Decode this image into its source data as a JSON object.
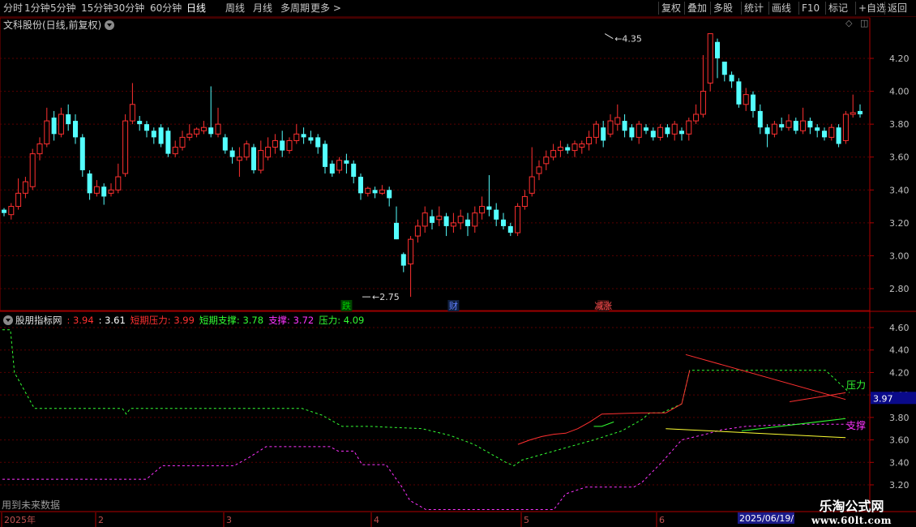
{
  "toolbar": {
    "left": [
      {
        "label": "分时",
        "active": false
      },
      {
        "label": "1分钟",
        "active": false
      },
      {
        "label": "5分钟",
        "active": false
      },
      {
        "label": "15分钟",
        "active": false
      },
      {
        "label": "30分钟",
        "active": false
      },
      {
        "label": "60分钟",
        "active": false
      },
      {
        "label": "日线",
        "active": true
      },
      {
        "label": "周线",
        "active": false
      },
      {
        "label": "月线",
        "active": false
      },
      {
        "label": "多周期",
        "active": false
      },
      {
        "label": "更多 >",
        "active": false
      }
    ],
    "right": [
      "复权",
      "叠加",
      "多股",
      "统计",
      "画线",
      "F10",
      "标记",
      "+自选",
      "返回"
    ]
  },
  "main_title": "文科股份(日线,前复权)",
  "indicator": {
    "name": "股朋指标网",
    "items": [
      {
        "label": "",
        "value": "3.94",
        "label_color": "#ff3030",
        "value_color": "#ff3030"
      },
      {
        "label": "",
        "value": "3.61",
        "label_color": "#ffffff",
        "value_color": "#ffffff"
      },
      {
        "label": "短期压力",
        "value": "3.99",
        "label_color": "#ff3030",
        "value_color": "#ff3030"
      },
      {
        "label": "短期支撑",
        "value": "3.78",
        "label_color": "#33ff33",
        "value_color": "#33ff33"
      },
      {
        "label": "支撑",
        "value": "3.72",
        "label_color": "#ff33ff",
        "value_color": "#ff33ff"
      },
      {
        "label": "压力",
        "value": "4.09",
        "label_color": "#33ff33",
        "value_color": "#33ff33"
      }
    ],
    "pressure_label": "压力",
    "support_label": "支撑",
    "current_value": "3.97"
  },
  "future_note": "用到未来数据",
  "watermark": {
    "line1": "乐淘公式网",
    "line2": "www.60lt.com"
  },
  "colors": {
    "up": "#ff3030",
    "down": "#54ffff",
    "grid": "#5a0000",
    "axis_text": "#c0c0c0"
  },
  "chart_data": {
    "type": "candlestick",
    "price_axis": {
      "ticks": [
        "4.20",
        "4.00",
        "3.80",
        "3.60",
        "3.40",
        "3.20",
        "3.00",
        "2.80"
      ],
      "range": [
        2.72,
        4.38
      ]
    },
    "indicator_axis": {
      "ticks": [
        "4.60",
        "4.40",
        "4.20",
        "4.00",
        "3.80",
        "3.60",
        "3.40",
        "3.20"
      ],
      "range": [
        3.12,
        4.68
      ]
    },
    "annotations": [
      {
        "text": "4.35",
        "index": 84,
        "value": 4.35
      },
      {
        "text": "2.75",
        "index": 50,
        "value": 2.75
      }
    ],
    "event_markers": [
      {
        "text": "跌",
        "index": 48,
        "color": "#00cc00",
        "bg": "#004400"
      },
      {
        "text": "财",
        "index": 63,
        "color": "#6080ff",
        "bg": "#102040"
      },
      {
        "text": "涨",
        "index": 84,
        "color": "#ff5050",
        "bg": "#401010",
        "prefix": "减"
      }
    ],
    "date_labels": [
      {
        "text": "2025年",
        "index": 0
      },
      {
        "text": "2",
        "index": 12
      },
      {
        "text": "3",
        "index": 28
      },
      {
        "text": "4",
        "index": 46
      },
      {
        "text": "5",
        "index": 65
      },
      {
        "text": "6",
        "index": 82
      }
    ],
    "date_cursor": "2025/06/19/",
    "candles": [
      [
        3.28,
        3.26,
        3.29,
        3.24
      ],
      [
        3.25,
        3.3,
        3.32,
        3.22
      ],
      [
        3.3,
        3.38,
        3.47,
        3.28
      ],
      [
        3.38,
        3.45,
        3.48,
        3.35
      ],
      [
        3.42,
        3.62,
        3.65,
        3.4
      ],
      [
        3.62,
        3.68,
        3.72,
        3.58
      ],
      [
        3.68,
        3.82,
        3.9,
        3.66
      ],
      [
        3.84,
        3.74,
        3.88,
        3.7
      ],
      [
        3.74,
        3.86,
        3.9,
        3.72
      ],
      [
        3.86,
        3.8,
        3.92,
        3.76
      ],
      [
        3.82,
        3.72,
        3.86,
        3.68
      ],
      [
        3.72,
        3.52,
        3.74,
        3.48
      ],
      [
        3.5,
        3.38,
        3.52,
        3.34
      ],
      [
        3.38,
        3.42,
        3.46,
        3.36
      ],
      [
        3.42,
        3.36,
        3.44,
        3.31
      ],
      [
        3.38,
        3.4,
        3.44,
        3.36
      ],
      [
        3.4,
        3.48,
        3.56,
        3.38
      ],
      [
        3.5,
        3.82,
        3.86,
        3.48
      ],
      [
        3.82,
        3.92,
        4.05,
        3.8
      ],
      [
        3.82,
        3.8,
        3.85,
        3.76
      ],
      [
        3.8,
        3.76,
        3.82,
        3.72
      ],
      [
        3.76,
        3.72,
        3.78,
        3.68
      ],
      [
        3.78,
        3.68,
        3.8,
        3.66
      ],
      [
        3.76,
        3.62,
        3.78,
        3.6
      ],
      [
        3.62,
        3.66,
        3.7,
        3.6
      ],
      [
        3.66,
        3.72,
        3.76,
        3.64
      ],
      [
        3.72,
        3.74,
        3.8,
        3.7
      ],
      [
        3.74,
        3.77,
        3.78,
        3.72
      ],
      [
        3.76,
        3.78,
        3.82,
        3.74
      ],
      [
        3.78,
        3.74,
        4.03,
        3.72
      ],
      [
        3.74,
        3.8,
        3.9,
        3.72
      ],
      [
        3.72,
        3.64,
        3.74,
        3.62
      ],
      [
        3.64,
        3.6,
        3.66,
        3.56
      ],
      [
        3.58,
        3.6,
        3.66,
        3.48
      ],
      [
        3.6,
        3.68,
        3.7,
        3.58
      ],
      [
        3.66,
        3.52,
        3.68,
        3.5
      ],
      [
        3.52,
        3.64,
        3.7,
        3.5
      ],
      [
        3.6,
        3.66,
        3.72,
        3.58
      ],
      [
        3.66,
        3.7,
        3.74,
        3.62
      ],
      [
        3.7,
        3.64,
        3.76,
        3.6
      ],
      [
        3.64,
        3.7,
        3.72,
        3.62
      ],
      [
        3.7,
        3.74,
        3.8,
        3.68
      ],
      [
        3.74,
        3.72,
        3.78,
        3.68
      ],
      [
        3.72,
        3.7,
        3.76,
        3.68
      ],
      [
        3.72,
        3.66,
        3.74,
        3.62
      ],
      [
        3.68,
        3.54,
        3.7,
        3.5
      ],
      [
        3.56,
        3.5,
        3.58,
        3.48
      ],
      [
        3.52,
        3.58,
        3.6,
        3.5
      ],
      [
        3.58,
        3.56,
        3.62,
        3.5
      ],
      [
        3.56,
        3.48,
        3.58,
        3.44
      ],
      [
        3.48,
        3.38,
        3.5,
        3.34
      ],
      [
        3.38,
        3.41,
        3.42,
        3.36
      ],
      [
        3.4,
        3.38,
        3.42,
        3.35
      ],
      [
        3.38,
        3.4,
        3.43,
        3.37
      ],
      [
        3.4,
        3.35,
        3.42,
        3.3
      ],
      [
        3.2,
        3.1,
        3.3,
        3.1
      ],
      [
        3.01,
        2.94,
        3.02,
        2.9
      ],
      [
        2.95,
        3.1,
        3.12,
        2.75
      ],
      [
        3.12,
        3.18,
        3.22,
        3.08
      ],
      [
        3.18,
        3.26,
        3.3,
        3.14
      ],
      [
        3.24,
        3.2,
        3.28,
        3.16
      ],
      [
        3.22,
        3.24,
        3.3,
        3.18
      ],
      [
        3.24,
        3.18,
        3.26,
        3.12
      ],
      [
        3.18,
        3.2,
        3.26,
        3.14
      ],
      [
        3.2,
        3.24,
        3.28,
        3.16
      ],
      [
        3.22,
        3.18,
        3.26,
        3.12
      ],
      [
        3.18,
        3.26,
        3.3,
        3.14
      ],
      [
        3.26,
        3.3,
        3.36,
        3.22
      ],
      [
        3.3,
        3.28,
        3.49,
        3.24
      ],
      [
        3.28,
        3.22,
        3.32,
        3.18
      ],
      [
        3.22,
        3.18,
        3.26,
        3.16
      ],
      [
        3.18,
        3.14,
        3.2,
        3.12
      ],
      [
        3.14,
        3.3,
        3.32,
        3.12
      ],
      [
        3.3,
        3.36,
        3.4,
        3.28
      ],
      [
        3.38,
        3.48,
        3.66,
        3.36
      ],
      [
        3.5,
        3.54,
        3.58,
        3.46
      ],
      [
        3.56,
        3.6,
        3.64,
        3.52
      ],
      [
        3.6,
        3.64,
        3.68,
        3.58
      ],
      [
        3.64,
        3.66,
        3.7,
        3.6
      ],
      [
        3.66,
        3.64,
        3.68,
        3.62
      ],
      [
        3.64,
        3.68,
        3.7,
        3.6
      ],
      [
        3.66,
        3.68,
        3.7,
        3.62
      ],
      [
        3.68,
        3.72,
        3.76,
        3.64
      ],
      [
        3.72,
        3.8,
        3.82,
        3.68
      ],
      [
        3.78,
        3.7,
        3.82,
        3.66
      ],
      [
        3.74,
        3.82,
        3.86,
        3.72
      ],
      [
        3.8,
        3.84,
        3.92,
        3.76
      ],
      [
        3.82,
        3.76,
        3.86,
        3.72
      ],
      [
        3.78,
        3.72,
        3.8,
        3.7
      ],
      [
        3.72,
        3.8,
        3.82,
        3.68
      ],
      [
        3.78,
        3.76,
        3.8,
        3.74
      ],
      [
        3.76,
        3.72,
        3.78,
        3.7
      ],
      [
        3.72,
        3.78,
        3.8,
        3.7
      ],
      [
        3.78,
        3.74,
        3.8,
        3.72
      ],
      [
        3.74,
        3.8,
        3.82,
        3.7
      ],
      [
        3.76,
        3.74,
        3.78,
        3.7
      ],
      [
        3.74,
        3.82,
        3.84,
        3.7
      ],
      [
        3.82,
        3.86,
        3.92,
        3.8
      ],
      [
        3.86,
        4.0,
        4.22,
        3.84
      ],
      [
        4.05,
        4.35,
        4.35,
        4.0
      ],
      [
        4.3,
        4.2,
        4.32,
        4.08
      ],
      [
        4.18,
        4.1,
        4.18,
        4.06
      ],
      [
        4.1,
        4.06,
        4.12,
        4.02
      ],
      [
        4.06,
        3.92,
        4.08,
        3.9
      ],
      [
        3.92,
        3.98,
        4.02,
        3.88
      ],
      [
        3.98,
        3.88,
        4.0,
        3.84
      ],
      [
        3.88,
        3.78,
        3.92,
        3.74
      ],
      [
        3.78,
        3.74,
        3.8,
        3.66
      ],
      [
        3.74,
        3.8,
        3.82,
        3.72
      ],
      [
        3.8,
        3.78,
        3.84,
        3.76
      ],
      [
        3.78,
        3.82,
        3.86,
        3.76
      ],
      [
        3.82,
        3.76,
        3.84,
        3.74
      ],
      [
        3.76,
        3.82,
        3.9,
        3.74
      ],
      [
        3.82,
        3.78,
        3.84,
        3.74
      ],
      [
        3.78,
        3.76,
        3.8,
        3.72
      ],
      [
        3.76,
        3.72,
        3.78,
        3.7
      ],
      [
        3.72,
        3.78,
        3.8,
        3.7
      ],
      [
        3.78,
        3.68,
        3.8,
        3.66
      ],
      [
        3.7,
        3.86,
        3.88,
        3.68
      ],
      [
        3.86,
        3.87,
        3.98,
        3.84
      ],
      [
        3.88,
        3.86,
        3.92,
        3.84
      ]
    ],
    "series": [
      {
        "name": "压力",
        "color": "#33ff33",
        "dashed": true,
        "points": [
          [
            0,
            4.58
          ],
          [
            2,
            4.58
          ],
          [
            3,
            4.2
          ],
          [
            8,
            3.88
          ],
          [
            30,
            3.88
          ],
          [
            31,
            3.83
          ],
          [
            32,
            3.88
          ],
          [
            70,
            3.88
          ],
          [
            75,
            3.88
          ],
          [
            80,
            3.82
          ],
          [
            85,
            3.72
          ],
          [
            92,
            3.72
          ],
          [
            105,
            3.7
          ],
          [
            112,
            3.64
          ],
          [
            118,
            3.56
          ],
          [
            126,
            3.4
          ],
          [
            128,
            3.37
          ],
          [
            130,
            3.42
          ],
          [
            138,
            3.5
          ],
          [
            148,
            3.6
          ],
          [
            155,
            3.68
          ],
          [
            160,
            3.78
          ],
          [
            162,
            3.84
          ],
          [
            165,
            3.84
          ],
          [
            170,
            3.92
          ],
          [
            172,
            4.22
          ],
          [
            206,
            4.22
          ],
          [
            212,
            4.02
          ]
        ]
      },
      {
        "name": "支撑",
        "color": "#ff33ff",
        "dashed": true,
        "points": [
          [
            0,
            3.25
          ],
          [
            36,
            3.25
          ],
          [
            40,
            3.37
          ],
          [
            58,
            3.37
          ],
          [
            62,
            3.45
          ],
          [
            66,
            3.54
          ],
          [
            82,
            3.54
          ],
          [
            84,
            3.5
          ],
          [
            88,
            3.5
          ],
          [
            90,
            3.38
          ],
          [
            96,
            3.38
          ],
          [
            100,
            3.18
          ],
          [
            102,
            3.06
          ],
          [
            106,
            2.98
          ],
          [
            138,
            2.98
          ],
          [
            141,
            3.12
          ],
          [
            146,
            3.18
          ],
          [
            158,
            3.18
          ],
          [
            160,
            3.22
          ],
          [
            165,
            3.4
          ],
          [
            170,
            3.6
          ],
          [
            176,
            3.65
          ],
          [
            180,
            3.69
          ],
          [
            186,
            3.72
          ],
          [
            198,
            3.74
          ],
          [
            212,
            3.74
          ]
        ]
      },
      {
        "name": "",
        "color": "#ff3030",
        "dashed": false,
        "points": [
          [
            129,
            3.56
          ],
          [
            132,
            3.6
          ],
          [
            135,
            3.63
          ],
          [
            138,
            3.65
          ],
          [
            141,
            3.66
          ],
          [
            144,
            3.7
          ],
          [
            147,
            3.76
          ],
          [
            150,
            3.83
          ],
          [
            160,
            3.84
          ],
          [
            166,
            3.84
          ],
          [
            170,
            3.92
          ],
          [
            172,
            4.22
          ]
        ]
      },
      {
        "name": "",
        "color": "#33ff33",
        "dashed": false,
        "points": [
          [
            148,
            3.72
          ],
          [
            150,
            3.72
          ],
          [
            153,
            3.76
          ]
        ]
      },
      {
        "name": "",
        "color": "#ff3030",
        "dashed": false,
        "points": [
          [
            171,
            4.36
          ],
          [
            211,
            3.96
          ]
        ]
      },
      {
        "name": "",
        "color": "#ff3030",
        "dashed": false,
        "points": [
          [
            197,
            3.94
          ],
          [
            211,
            4.02
          ]
        ]
      },
      {
        "name": "",
        "color": "#ffff33",
        "dashed": false,
        "points": [
          [
            166,
            3.7
          ],
          [
            211,
            3.62
          ]
        ]
      },
      {
        "name": "",
        "color": "#33ff33",
        "dashed": false,
        "points": [
          [
            185,
            3.68
          ],
          [
            211,
            3.79
          ]
        ]
      }
    ]
  }
}
